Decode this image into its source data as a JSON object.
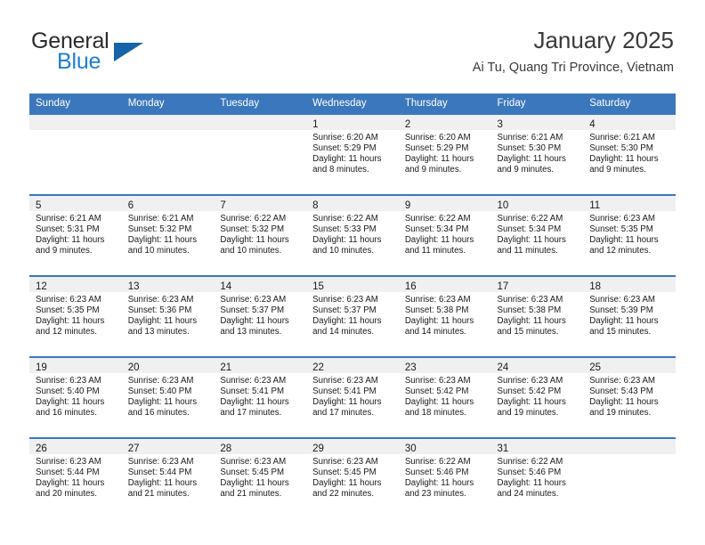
{
  "brand": {
    "word_one": "General",
    "word_two": "Blue",
    "logo_icon": "triangle-logo-icon",
    "accent_color": "#1b7fd4",
    "triangle_color": "#1663a8"
  },
  "header": {
    "title": "January 2025",
    "subtitle": "Ai Tu, Quang Tri Province, Vietnam"
  },
  "calendar": {
    "header_bg_color": "#3b77bc",
    "daynum_band_color": "#f0f0f0",
    "weekday_headers": [
      "Sunday",
      "Monday",
      "Tuesday",
      "Wednesday",
      "Thursday",
      "Friday",
      "Saturday"
    ],
    "weeks": [
      [
        {
          "day": "",
          "empty": true
        },
        {
          "day": "",
          "empty": true
        },
        {
          "day": "",
          "empty": true
        },
        {
          "day": "1",
          "sunrise": "Sunrise: 6:20 AM",
          "sunset": "Sunset: 5:29 PM",
          "daylight_1": "Daylight: 11 hours",
          "daylight_2": "and 8 minutes."
        },
        {
          "day": "2",
          "sunrise": "Sunrise: 6:20 AM",
          "sunset": "Sunset: 5:29 PM",
          "daylight_1": "Daylight: 11 hours",
          "daylight_2": "and 9 minutes."
        },
        {
          "day": "3",
          "sunrise": "Sunrise: 6:21 AM",
          "sunset": "Sunset: 5:30 PM",
          "daylight_1": "Daylight: 11 hours",
          "daylight_2": "and 9 minutes."
        },
        {
          "day": "4",
          "sunrise": "Sunrise: 6:21 AM",
          "sunset": "Sunset: 5:30 PM",
          "daylight_1": "Daylight: 11 hours",
          "daylight_2": "and 9 minutes."
        }
      ],
      [
        {
          "day": "5",
          "sunrise": "Sunrise: 6:21 AM",
          "sunset": "Sunset: 5:31 PM",
          "daylight_1": "Daylight: 11 hours",
          "daylight_2": "and 9 minutes."
        },
        {
          "day": "6",
          "sunrise": "Sunrise: 6:21 AM",
          "sunset": "Sunset: 5:32 PM",
          "daylight_1": "Daylight: 11 hours",
          "daylight_2": "and 10 minutes."
        },
        {
          "day": "7",
          "sunrise": "Sunrise: 6:22 AM",
          "sunset": "Sunset: 5:32 PM",
          "daylight_1": "Daylight: 11 hours",
          "daylight_2": "and 10 minutes."
        },
        {
          "day": "8",
          "sunrise": "Sunrise: 6:22 AM",
          "sunset": "Sunset: 5:33 PM",
          "daylight_1": "Daylight: 11 hours",
          "daylight_2": "and 10 minutes."
        },
        {
          "day": "9",
          "sunrise": "Sunrise: 6:22 AM",
          "sunset": "Sunset: 5:34 PM",
          "daylight_1": "Daylight: 11 hours",
          "daylight_2": "and 11 minutes."
        },
        {
          "day": "10",
          "sunrise": "Sunrise: 6:22 AM",
          "sunset": "Sunset: 5:34 PM",
          "daylight_1": "Daylight: 11 hours",
          "daylight_2": "and 11 minutes."
        },
        {
          "day": "11",
          "sunrise": "Sunrise: 6:23 AM",
          "sunset": "Sunset: 5:35 PM",
          "daylight_1": "Daylight: 11 hours",
          "daylight_2": "and 12 minutes."
        }
      ],
      [
        {
          "day": "12",
          "sunrise": "Sunrise: 6:23 AM",
          "sunset": "Sunset: 5:35 PM",
          "daylight_1": "Daylight: 11 hours",
          "daylight_2": "and 12 minutes."
        },
        {
          "day": "13",
          "sunrise": "Sunrise: 6:23 AM",
          "sunset": "Sunset: 5:36 PM",
          "daylight_1": "Daylight: 11 hours",
          "daylight_2": "and 13 minutes."
        },
        {
          "day": "14",
          "sunrise": "Sunrise: 6:23 AM",
          "sunset": "Sunset: 5:37 PM",
          "daylight_1": "Daylight: 11 hours",
          "daylight_2": "and 13 minutes."
        },
        {
          "day": "15",
          "sunrise": "Sunrise: 6:23 AM",
          "sunset": "Sunset: 5:37 PM",
          "daylight_1": "Daylight: 11 hours",
          "daylight_2": "and 14 minutes."
        },
        {
          "day": "16",
          "sunrise": "Sunrise: 6:23 AM",
          "sunset": "Sunset: 5:38 PM",
          "daylight_1": "Daylight: 11 hours",
          "daylight_2": "and 14 minutes."
        },
        {
          "day": "17",
          "sunrise": "Sunrise: 6:23 AM",
          "sunset": "Sunset: 5:38 PM",
          "daylight_1": "Daylight: 11 hours",
          "daylight_2": "and 15 minutes."
        },
        {
          "day": "18",
          "sunrise": "Sunrise: 6:23 AM",
          "sunset": "Sunset: 5:39 PM",
          "daylight_1": "Daylight: 11 hours",
          "daylight_2": "and 15 minutes."
        }
      ],
      [
        {
          "day": "19",
          "sunrise": "Sunrise: 6:23 AM",
          "sunset": "Sunset: 5:40 PM",
          "daylight_1": "Daylight: 11 hours",
          "daylight_2": "and 16 minutes."
        },
        {
          "day": "20",
          "sunrise": "Sunrise: 6:23 AM",
          "sunset": "Sunset: 5:40 PM",
          "daylight_1": "Daylight: 11 hours",
          "daylight_2": "and 16 minutes."
        },
        {
          "day": "21",
          "sunrise": "Sunrise: 6:23 AM",
          "sunset": "Sunset: 5:41 PM",
          "daylight_1": "Daylight: 11 hours",
          "daylight_2": "and 17 minutes."
        },
        {
          "day": "22",
          "sunrise": "Sunrise: 6:23 AM",
          "sunset": "Sunset: 5:41 PM",
          "daylight_1": "Daylight: 11 hours",
          "daylight_2": "and 17 minutes."
        },
        {
          "day": "23",
          "sunrise": "Sunrise: 6:23 AM",
          "sunset": "Sunset: 5:42 PM",
          "daylight_1": "Daylight: 11 hours",
          "daylight_2": "and 18 minutes."
        },
        {
          "day": "24",
          "sunrise": "Sunrise: 6:23 AM",
          "sunset": "Sunset: 5:42 PM",
          "daylight_1": "Daylight: 11 hours",
          "daylight_2": "and 19 minutes."
        },
        {
          "day": "25",
          "sunrise": "Sunrise: 6:23 AM",
          "sunset": "Sunset: 5:43 PM",
          "daylight_1": "Daylight: 11 hours",
          "daylight_2": "and 19 minutes."
        }
      ],
      [
        {
          "day": "26",
          "sunrise": "Sunrise: 6:23 AM",
          "sunset": "Sunset: 5:44 PM",
          "daylight_1": "Daylight: 11 hours",
          "daylight_2": "and 20 minutes."
        },
        {
          "day": "27",
          "sunrise": "Sunrise: 6:23 AM",
          "sunset": "Sunset: 5:44 PM",
          "daylight_1": "Daylight: 11 hours",
          "daylight_2": "and 21 minutes."
        },
        {
          "day": "28",
          "sunrise": "Sunrise: 6:23 AM",
          "sunset": "Sunset: 5:45 PM",
          "daylight_1": "Daylight: 11 hours",
          "daylight_2": "and 21 minutes."
        },
        {
          "day": "29",
          "sunrise": "Sunrise: 6:23 AM",
          "sunset": "Sunset: 5:45 PM",
          "daylight_1": "Daylight: 11 hours",
          "daylight_2": "and 22 minutes."
        },
        {
          "day": "30",
          "sunrise": "Sunrise: 6:22 AM",
          "sunset": "Sunset: 5:46 PM",
          "daylight_1": "Daylight: 11 hours",
          "daylight_2": "and 23 minutes."
        },
        {
          "day": "31",
          "sunrise": "Sunrise: 6:22 AM",
          "sunset": "Sunset: 5:46 PM",
          "daylight_1": "Daylight: 11 hours",
          "daylight_2": "and 24 minutes."
        },
        {
          "day": "",
          "empty": true
        }
      ]
    ]
  }
}
